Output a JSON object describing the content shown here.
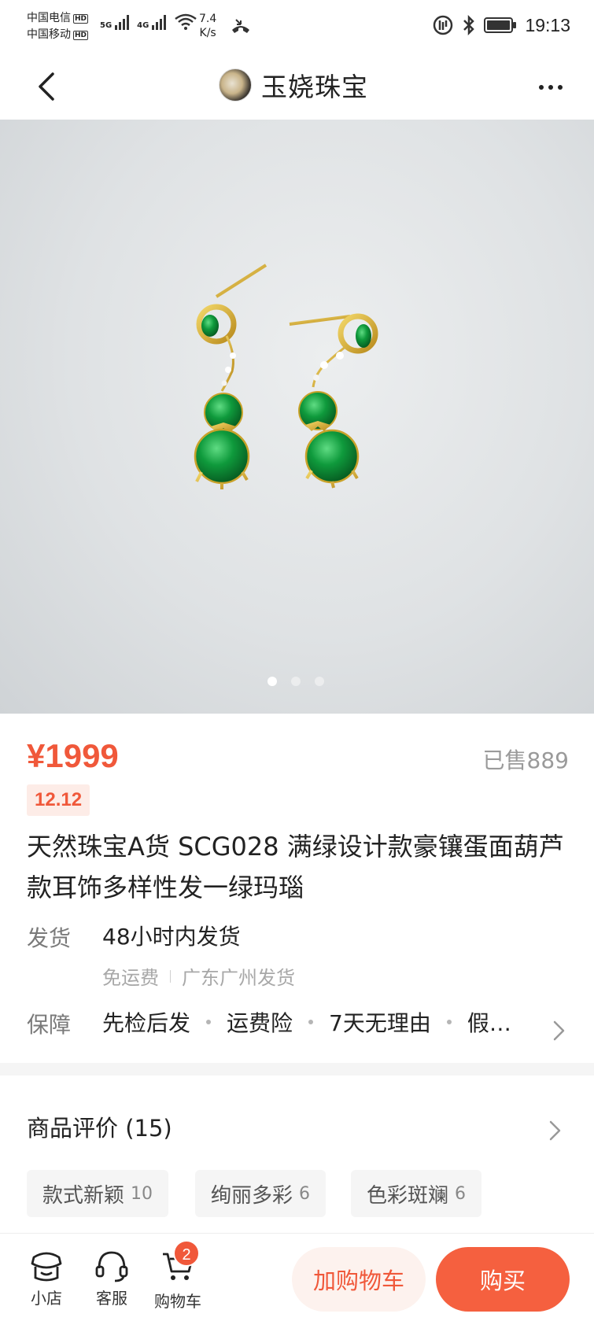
{
  "status_bar": {
    "carrier_1": "中国电信",
    "carrier_2": "中国移动",
    "hd_label": "HD",
    "net_1": "5G",
    "net_2": "4G",
    "speed_value": "7.4",
    "speed_unit": "K/s",
    "time": "19:13"
  },
  "nav": {
    "shop_name": "玉娆珠宝"
  },
  "gallery": {
    "image_count": 3,
    "active_index": 0
  },
  "product": {
    "price": "¥1999",
    "sold": "已售889",
    "promo_tag": "12.12",
    "title": "天然珠宝A货 SCG028 满绿设计款豪镶蛋面葫芦款耳饰多样性发一绿玛瑙"
  },
  "shipping": {
    "label": "发货",
    "main": "48小时内发货",
    "free_shipping": "免运费",
    "origin": "广东广州发货"
  },
  "guarantee": {
    "label": "保障",
    "items": [
      "先检后发",
      "运费险",
      "7天无理由",
      "假…"
    ]
  },
  "reviews": {
    "title": "商品评价 (15)",
    "tags": [
      {
        "label": "款式新颖",
        "count": "10"
      },
      {
        "label": "绚丽多彩",
        "count": "6"
      },
      {
        "label": "色彩斑斓",
        "count": "6"
      }
    ]
  },
  "bottom_bar": {
    "shop_label": "小店",
    "service_label": "客服",
    "cart_label": "购物车",
    "cart_badge": "2",
    "add_to_cart": "加购物车",
    "buy": "购买"
  },
  "colors": {
    "accent": "#f0583a",
    "buy_button": "#f5603f",
    "cart_button_bg": "#fdf2ee"
  },
  "icons": [
    "back-arrow-icon",
    "more-dots-icon",
    "chevron-right-icon",
    "shop-icon",
    "headset-icon",
    "cart-icon"
  ]
}
